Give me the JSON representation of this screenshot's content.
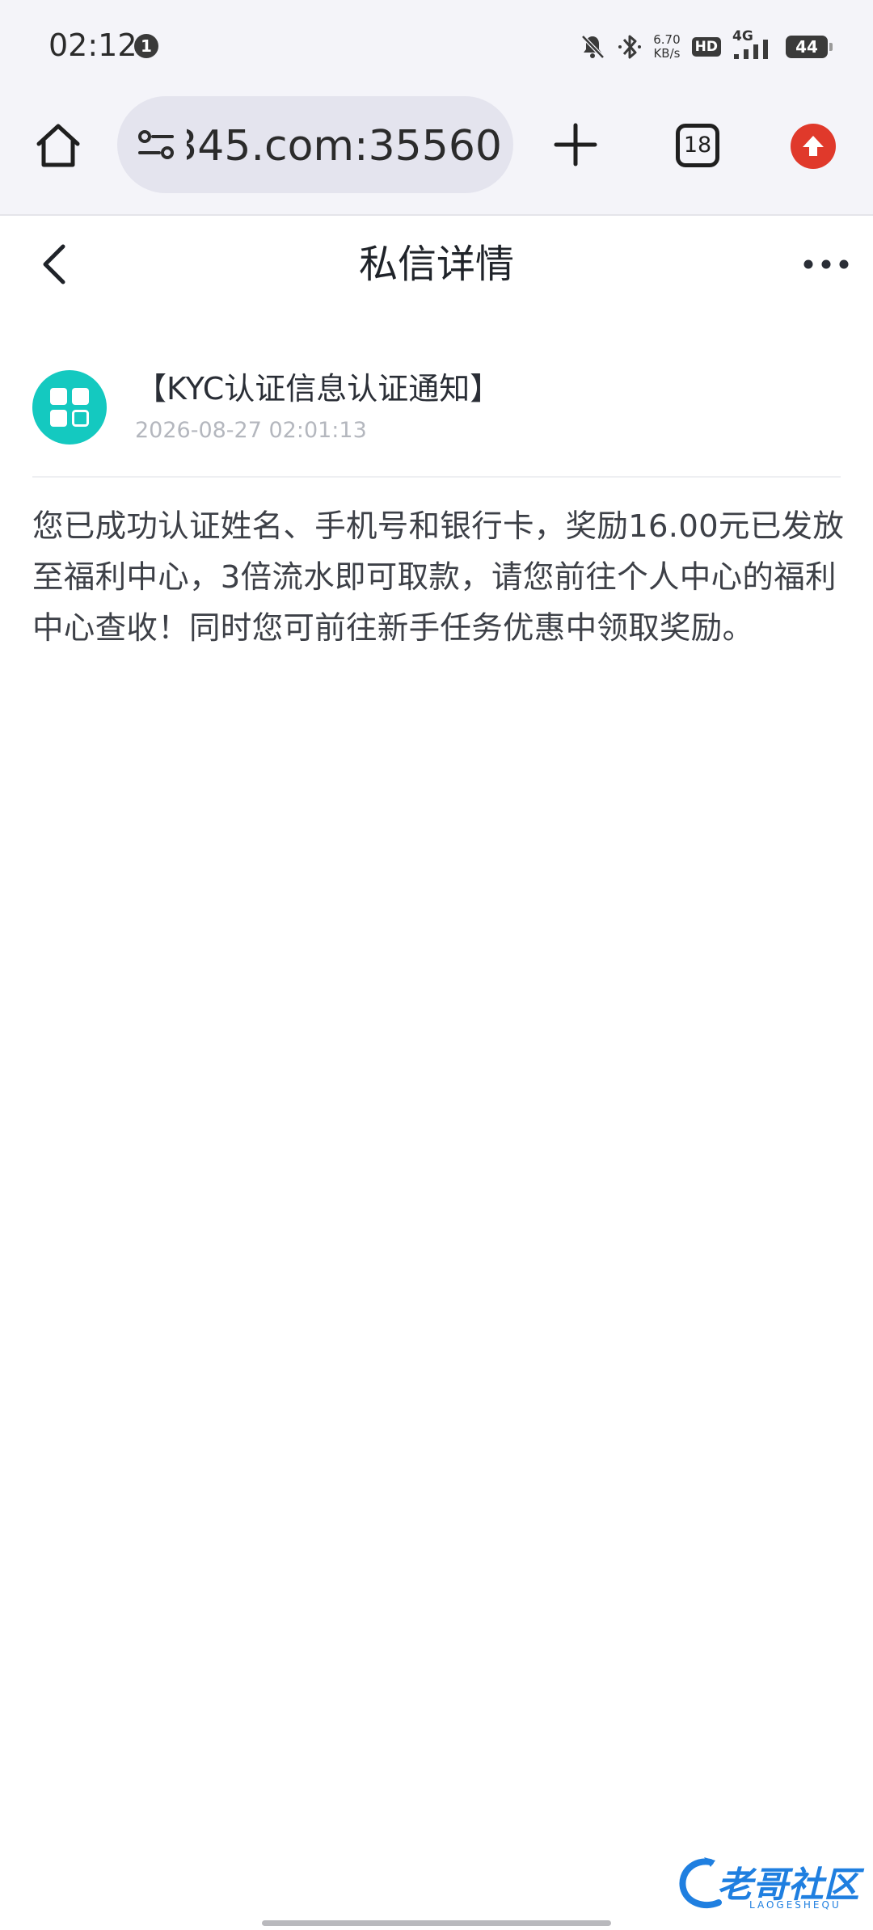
{
  "status_bar": {
    "time": "02:12",
    "notification_count": "1",
    "net_speed_value": "6.70",
    "net_speed_unit": "KB/s",
    "hd_label": "HD",
    "network_label": "4G",
    "battery_level": "44"
  },
  "browser": {
    "url": "345.com:35560",
    "tab_count": "18",
    "update_color": "#e0392b"
  },
  "header": {
    "title": "私信详情"
  },
  "message": {
    "title": "【KYC认证信息认证通知】",
    "time": "2026-08-27 02:01:13",
    "body": "您已成功认证姓名、手机号和银行卡，奖励16.00元已发放至福利中心，3倍流水即可取款，请您前往个人中心的福利中心查收！同时您可前往新手任务优惠中领取奖励。",
    "avatar_color": "#14c9c0"
  },
  "watermark": {
    "text": "老哥社区",
    "subtext": "LAOGESHEQU"
  }
}
